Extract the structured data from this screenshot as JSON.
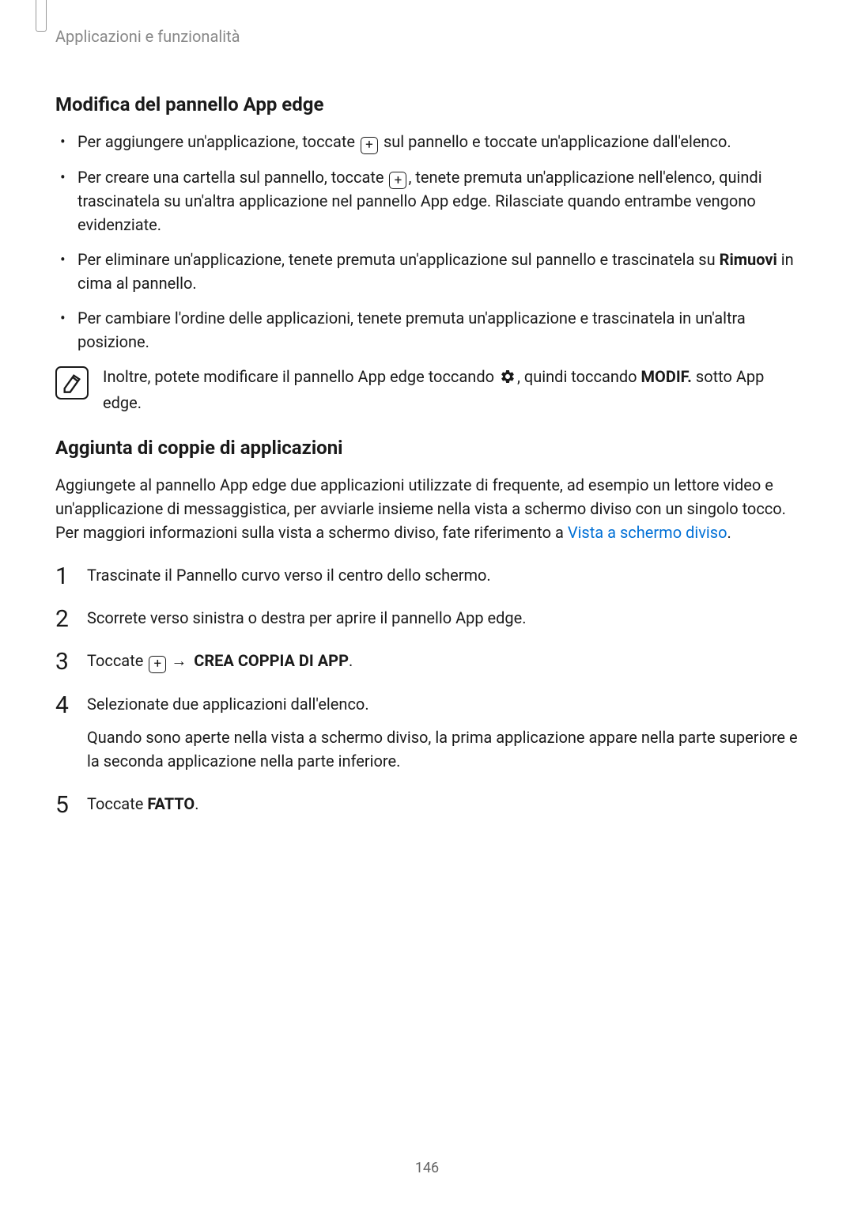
{
  "header": {
    "breadcrumb": "Applicazioni e funzionalità"
  },
  "section1": {
    "title": "Modifica del pannello App edge",
    "bullets": {
      "b1_before": "Per aggiungere un'applicazione, toccate ",
      "b1_after": " sul pannello e toccate un'applicazione dall'elenco.",
      "b2_before": "Per creare una cartella sul pannello, toccate ",
      "b2_after": ", tenete premuta un'applicazione nell'elenco, quindi trascinatela su un'altra applicazione nel pannello App edge. Rilasciate quando entrambe vengono evidenziate.",
      "b3_before": "Per eliminare un'applicazione, tenete premuta un'applicazione sul pannello e trascinatela su ",
      "b3_bold": "Rimuovi",
      "b3_after": " in cima al pannello.",
      "b4": "Per cambiare l'ordine delle applicazioni, tenete premuta un'applicazione e trascinatela in un'altra posizione."
    },
    "note": {
      "before": "Inoltre, potete modificare il pannello App edge toccando ",
      "mid": ", quindi toccando ",
      "bold": "MODIF.",
      "after": " sotto App edge."
    }
  },
  "section2": {
    "title": "Aggiunta di coppie di applicazioni",
    "intro_before": "Aggiungete al pannello App edge due applicazioni utilizzate di frequente, ad esempio un lettore video e un'applicazione di messaggistica, per avviarle insieme nella vista a schermo diviso con un singolo tocco. Per maggiori informazioni sulla vista a schermo diviso, fate riferimento a ",
    "intro_link": "Vista a schermo diviso",
    "intro_after": ".",
    "steps": {
      "s1": "Trascinate il Pannello curvo verso il centro dello schermo.",
      "s2": "Scorrete verso sinistra o destra per aprire il pannello App edge.",
      "s3_before": "Toccate ",
      "s3_arrow": "→",
      "s3_bold": "CREA COPPIA DI APP",
      "s3_after": ".",
      "s4": "Selezionate due applicazioni dall'elenco.",
      "s4_sub": "Quando sono aperte nella vista a schermo diviso, la prima applicazione appare nella parte superiore e la seconda applicazione nella parte inferiore.",
      "s5_before": "Toccate ",
      "s5_bold": "FATTO",
      "s5_after": "."
    }
  },
  "page_number": "146"
}
